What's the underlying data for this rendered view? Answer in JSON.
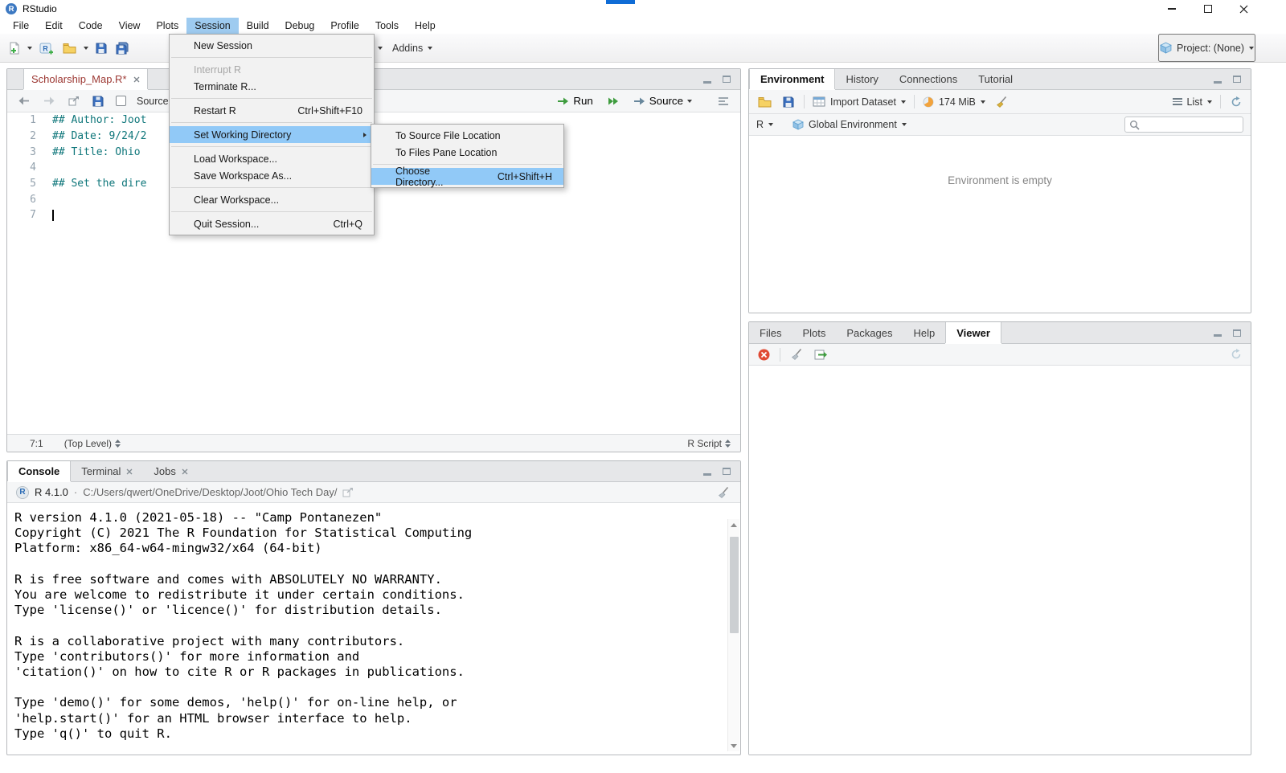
{
  "window": {
    "title": "RStudio"
  },
  "menubar": {
    "items": [
      {
        "label": "File"
      },
      {
        "label": "Edit"
      },
      {
        "label": "Code"
      },
      {
        "label": "View"
      },
      {
        "label": "Plots"
      },
      {
        "label": "Session",
        "open": true
      },
      {
        "label": "Build"
      },
      {
        "label": "Debug"
      },
      {
        "label": "Profile"
      },
      {
        "label": "Tools"
      },
      {
        "label": "Help"
      }
    ]
  },
  "main_toolbar": {
    "addins_label": "Addins",
    "project_label": "Project: (None)"
  },
  "session_menu": {
    "items": [
      {
        "label": "New Session"
      },
      {
        "separator": true
      },
      {
        "label": "Interrupt R",
        "disabled": true
      },
      {
        "label": "Terminate R..."
      },
      {
        "separator": true
      },
      {
        "label": "Restart R",
        "shortcut": "Ctrl+Shift+F10"
      },
      {
        "separator": true
      },
      {
        "label": "Set Working Directory",
        "highlighted": true,
        "has_submenu": true
      },
      {
        "separator": true
      },
      {
        "label": "Load Workspace..."
      },
      {
        "label": "Save Workspace As..."
      },
      {
        "separator": true
      },
      {
        "label": "Clear Workspace..."
      },
      {
        "separator": true
      },
      {
        "label": "Quit Session...",
        "shortcut": "Ctrl+Q"
      }
    ]
  },
  "working_directory_submenu": {
    "items": [
      {
        "label": "To Source File Location"
      },
      {
        "label": "To Files Pane Location"
      },
      {
        "separator": true
      },
      {
        "label": "Choose Directory...",
        "shortcut": "Ctrl+Shift+H",
        "highlighted": true
      }
    ]
  },
  "source_pane": {
    "tab_title": "Scholarship_Map.R*",
    "toolbar": {
      "source_on_save_label": "Source",
      "run_label": "Run",
      "source_button_label": "Source"
    },
    "lines": [
      {
        "num": "1",
        "code": "## Author: Joot"
      },
      {
        "num": "2",
        "code": "## Date: 9/24/2"
      },
      {
        "num": "3",
        "code": "## Title: Ohio"
      },
      {
        "num": "4",
        "code": ""
      },
      {
        "num": "5",
        "code": "## Set the dire"
      },
      {
        "num": "6",
        "code": ""
      },
      {
        "num": "7",
        "code": ""
      }
    ],
    "statusbar": {
      "cursor_position": "7:1",
      "scope": "(Top Level)",
      "file_type": "R Script"
    }
  },
  "console_pane": {
    "tabs": [
      {
        "label": "Console",
        "active": true
      },
      {
        "label": "Terminal",
        "closable": true
      },
      {
        "label": "Jobs",
        "closable": true
      }
    ],
    "r_version": "R 4.1.0",
    "separator": "·",
    "working_directory": "C:/Users/qwert/OneDrive/Desktop/Joot/Ohio Tech Day/",
    "output_lines": [
      "R version 4.1.0 (2021-05-18) -- \"Camp Pontanezen\"",
      "Copyright (C) 2021 The R Foundation for Statistical Computing",
      "Platform: x86_64-w64-mingw32/x64 (64-bit)",
      "",
      "R is free software and comes with ABSOLUTELY NO WARRANTY.",
      "You are welcome to redistribute it under certain conditions.",
      "Type 'license()' or 'licence()' for distribution details.",
      "",
      "R is a collaborative project with many contributors.",
      "Type 'contributors()' for more information and",
      "'citation()' on how to cite R or R packages in publications.",
      "",
      "Type 'demo()' for some demos, 'help()' for on-line help, or",
      "'help.start()' for an HTML browser interface to help.",
      "Type 'q()' to quit R."
    ]
  },
  "environment_pane": {
    "tabs": [
      {
        "label": "Environment",
        "active": true
      },
      {
        "label": "History"
      },
      {
        "label": "Connections"
      },
      {
        "label": "Tutorial"
      }
    ],
    "import_dataset_label": "Import Dataset",
    "memory_usage": "174 MiB",
    "view_mode": "List",
    "language": "R",
    "scope": "Global Environment",
    "empty_message": "Environment is empty"
  },
  "files_pane": {
    "tabs": [
      {
        "label": "Files"
      },
      {
        "label": "Plots"
      },
      {
        "label": "Packages"
      },
      {
        "label": "Help"
      },
      {
        "label": "Viewer",
        "active": true
      }
    ]
  }
}
